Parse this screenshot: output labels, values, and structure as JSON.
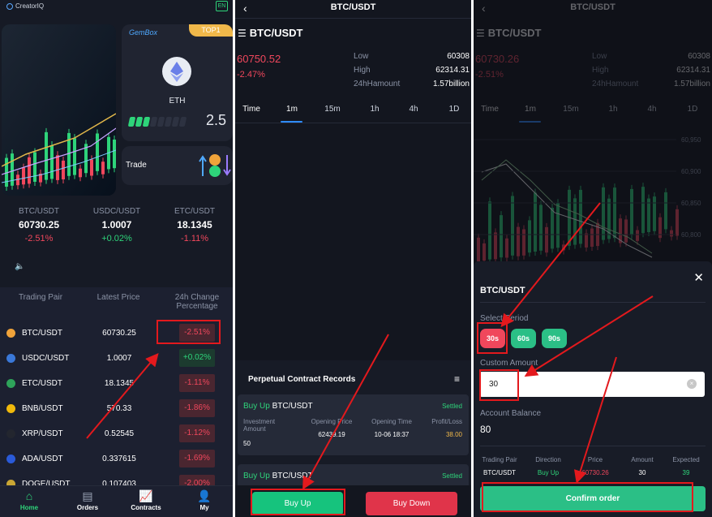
{
  "home": {
    "logo_text": "CreatorIQ",
    "lang": "EN",
    "gembox": {
      "title": "GemBox",
      "badge": "TOP1",
      "coin": "ETH",
      "value": "2.5",
      "level_filled": 3,
      "level_total": 8
    },
    "trade_label": "Trade",
    "tickers": [
      {
        "pair": "BTC/USDT",
        "price": "60730.25",
        "change": "-2.51%",
        "dir": "down"
      },
      {
        "pair": "USDC/USDT",
        "price": "1.0007",
        "change": "+0.02%",
        "dir": "up"
      },
      {
        "pair": "ETC/USDT",
        "price": "18.1345",
        "change": "-1.11%",
        "dir": "down"
      }
    ],
    "table": {
      "headers": [
        "Trading Pair",
        "Latest Price",
        "24h Change Percentage"
      ],
      "rows": [
        {
          "pair": "BTC/USDT",
          "price": "60730.25",
          "change": "-2.51%",
          "dir": "down",
          "icon_color": "#f0a33a",
          "icon": "bitcoin-icon"
        },
        {
          "pair": "USDC/USDT",
          "price": "1.0007",
          "change": "+0.02%",
          "dir": "up",
          "icon_color": "#3a78d8",
          "icon": "usdc-icon"
        },
        {
          "pair": "ETC/USDT",
          "price": "18.1345",
          "change": "-1.11%",
          "dir": "down",
          "icon_color": "#2ea35a",
          "icon": "etc-icon"
        },
        {
          "pair": "BNB/USDT",
          "price": "570.33",
          "change": "-1.86%",
          "dir": "down",
          "icon_color": "#f0b90b",
          "icon": "bnb-icon"
        },
        {
          "pair": "XRP/USDT",
          "price": "0.52545",
          "change": "-1.12%",
          "dir": "down",
          "icon_color": "#23262f",
          "icon": "xrp-icon"
        },
        {
          "pair": "ADA/USDT",
          "price": "0.337615",
          "change": "-1.69%",
          "dir": "down",
          "icon_color": "#2a5ad8",
          "icon": "ada-icon"
        },
        {
          "pair": "DOGE/USDT",
          "price": "0.107403",
          "change": "-2.00%",
          "dir": "down",
          "icon_color": "#c9a634",
          "icon": "doge-icon"
        }
      ]
    },
    "tabs": [
      {
        "label": "Home",
        "icon": "home-icon",
        "active": true
      },
      {
        "label": "Orders",
        "icon": "orders-icon",
        "active": false
      },
      {
        "label": "Contracts",
        "icon": "contracts-icon",
        "active": false
      },
      {
        "label": "My",
        "icon": "profile-icon",
        "active": false
      }
    ]
  },
  "detail": {
    "nav_title": "BTC/USDT",
    "pair": "BTC/USDT",
    "price": "60750.52",
    "change": "-2.47%",
    "low_label": "Low",
    "low": "60308",
    "high_label": "High",
    "high": "62314.31",
    "amount_label": "24hHamount",
    "amount": "1.57billion",
    "timeframes": [
      "Time",
      "1m",
      "15m",
      "1h",
      "4h",
      "1D"
    ],
    "active_timeframe": "1m",
    "records_title": "Perpetual Contract Records",
    "records": [
      {
        "direction": "Buy Up",
        "pair": "BTC/USDT",
        "status": "Settled",
        "cols": [
          "Investment Amount",
          "Opening Price",
          "Opening Time",
          "Profit/Loss"
        ],
        "vals": [
          "50",
          "62439.19",
          "10-06 18:37",
          "38.00"
        ]
      },
      {
        "direction": "Buy Up",
        "pair": "BTC/USDT",
        "status": "Settled"
      }
    ],
    "buy_up": "Buy Up",
    "buy_down": "Buy Down"
  },
  "order": {
    "nav_title": "BTC/USDT",
    "pair": "BTC/USDT",
    "price": "60730.26",
    "change": "-2.51%",
    "low_label": "Low",
    "low": "60308",
    "high_label": "High",
    "high": "62314.31",
    "amount_label": "24hHamount",
    "amount": "1.57billion",
    "timeframes": [
      "Time",
      "1m",
      "15m",
      "1h",
      "4h",
      "1D"
    ],
    "y_ticks": [
      "60,950",
      "60,900",
      "60,850",
      "60,800"
    ],
    "sheet_title": "BTC/USDT",
    "period_label": "Select Period",
    "periods": [
      "30s",
      "60s",
      "90s"
    ],
    "selected_period": "30s",
    "custom_amount_label": "Custom Amount",
    "custom_amount": "30",
    "balance_label": "Account Balance",
    "balance": "80",
    "summary_headers": [
      "Trading Pair",
      "Direction",
      "Price",
      "Amount",
      "Expected"
    ],
    "summary_values": [
      "BTC/USDT",
      "Buy Up",
      "60730.26",
      "30",
      "39"
    ],
    "confirm_label": "Confirm order"
  }
}
